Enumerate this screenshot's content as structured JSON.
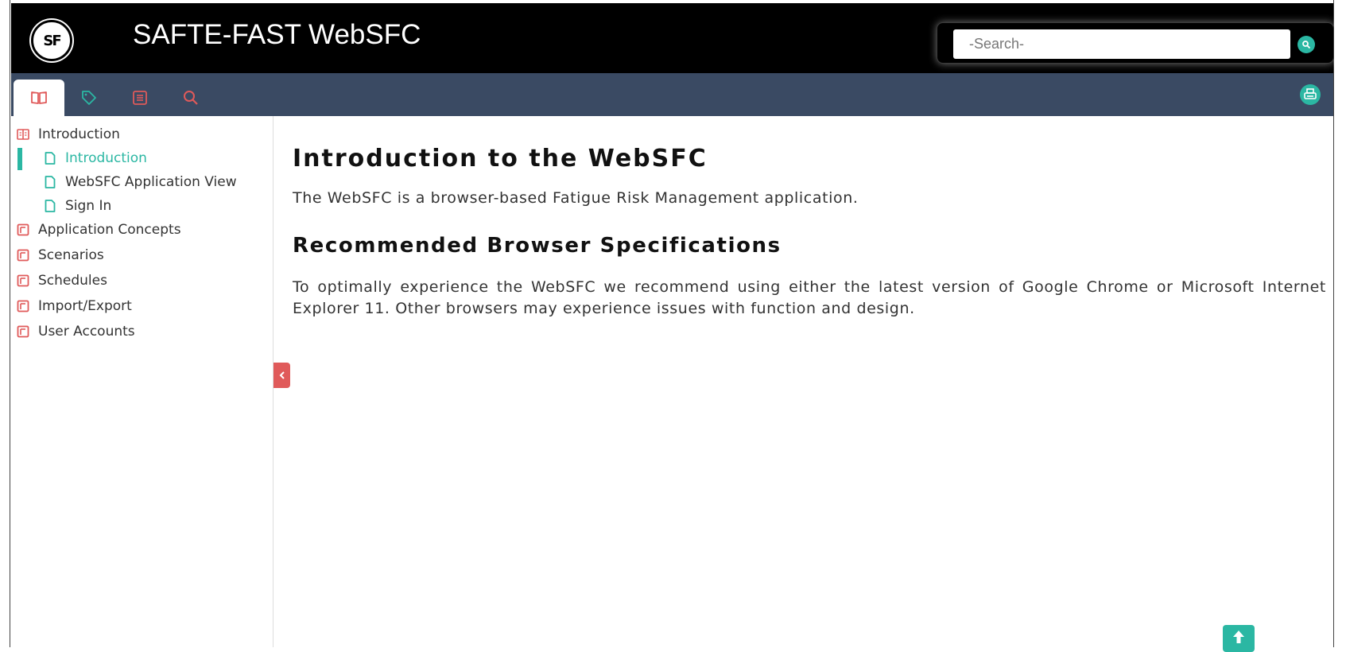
{
  "header": {
    "logo_text": "SF",
    "app_title": "SAFTE-FAST WebSFC",
    "search": {
      "placeholder": "-Search-",
      "value": ""
    }
  },
  "toolbar": {
    "tabs": [
      {
        "icon": "book-icon",
        "active": true
      },
      {
        "icon": "tag-icon",
        "active": false
      },
      {
        "icon": "list-icon",
        "active": false
      },
      {
        "icon": "search-icon",
        "active": false
      }
    ],
    "print_icon": "print-icon"
  },
  "sidebar": {
    "items": [
      {
        "label": "Introduction",
        "icon": "open-book-icon"
      },
      {
        "label": "Introduction",
        "icon": "page-icon",
        "active": true
      },
      {
        "label": "WebSFC Application View",
        "icon": "page-icon"
      },
      {
        "label": "Sign In",
        "icon": "page-icon"
      },
      {
        "label": "Application Concepts",
        "icon": "closed-book-icon"
      },
      {
        "label": "Scenarios",
        "icon": "closed-book-icon"
      },
      {
        "label": "Schedules",
        "icon": "closed-book-icon"
      },
      {
        "label": "Import/Export",
        "icon": "closed-book-icon"
      },
      {
        "label": "User Accounts",
        "icon": "closed-book-icon"
      }
    ]
  },
  "content": {
    "heading": "Introduction to the WebSFC",
    "intro": "The WebSFC is a browser-based Fatigue Risk Management application.",
    "subheading": "Recommended Browser Specifications",
    "spec_text": "To optimally experience the WebSFC we recommend using either the latest version of Google Chrome or Microsoft Internet Explorer 11. Other browsers may experience issues with function and design."
  },
  "colors": {
    "accent": "#2bb7a3",
    "secondary": "#e05a5a",
    "toolbar": "#3a4a63",
    "header": "#000000"
  }
}
